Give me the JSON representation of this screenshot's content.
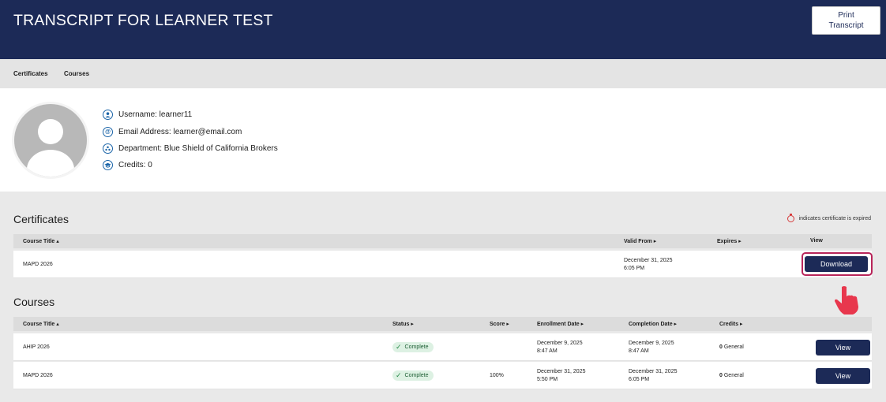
{
  "header": {
    "title": "TRANSCRIPT FOR LEARNER TEST",
    "print_label": "Print\nTranscript"
  },
  "tabs": [
    {
      "label": "Certificates"
    },
    {
      "label": "Courses"
    }
  ],
  "profile": {
    "username": "Username: learner11",
    "email": "Email Address: learner@email.com",
    "department": "Department: Blue Shield of California Brokers",
    "credits": "Credits: 0"
  },
  "certificates": {
    "title": "Certificates",
    "expired_note": "indicates certificate is expired",
    "columns": {
      "course_title": "Course Title ▴",
      "valid_from": "Valid From ▸",
      "expires": "Expires ▸",
      "view": "View"
    },
    "rows": [
      {
        "course_title": "MAPD 2026",
        "valid_from_date": "December 31, 2025",
        "valid_from_time": "6:05 PM",
        "expires": "",
        "action": "Download"
      }
    ]
  },
  "courses": {
    "title": "Courses",
    "columns": {
      "course_title": "Course Title ▴",
      "status": "Status ▸",
      "score": "Score ▸",
      "enrollment_date": "Enrollment Date ▸",
      "completion_date": "Completion Date ▸",
      "credits": "Credits ▸"
    },
    "rows": [
      {
        "course_title": "AHIP 2026",
        "status": "Complete",
        "score": "",
        "enroll_date": "December 9, 2025",
        "enroll_time": "8:47 AM",
        "complete_date": "December 9, 2025",
        "complete_time": "8:47 AM",
        "credits_num": "0",
        "credits_type": "General",
        "action": "View"
      },
      {
        "course_title": "MAPD 2026",
        "status": "Complete",
        "score": "100%",
        "enroll_date": "December 31, 2025",
        "enroll_time": "5:50 PM",
        "complete_date": "December 31, 2025",
        "complete_time": "6:05 PM",
        "credits_num": "0",
        "credits_type": "General",
        "action": "View"
      }
    ]
  },
  "colors": {
    "header": "#1c2a57",
    "highlight": "#b8255a",
    "badge_bg": "#ddf1e3",
    "pointer": "#e8374d"
  }
}
